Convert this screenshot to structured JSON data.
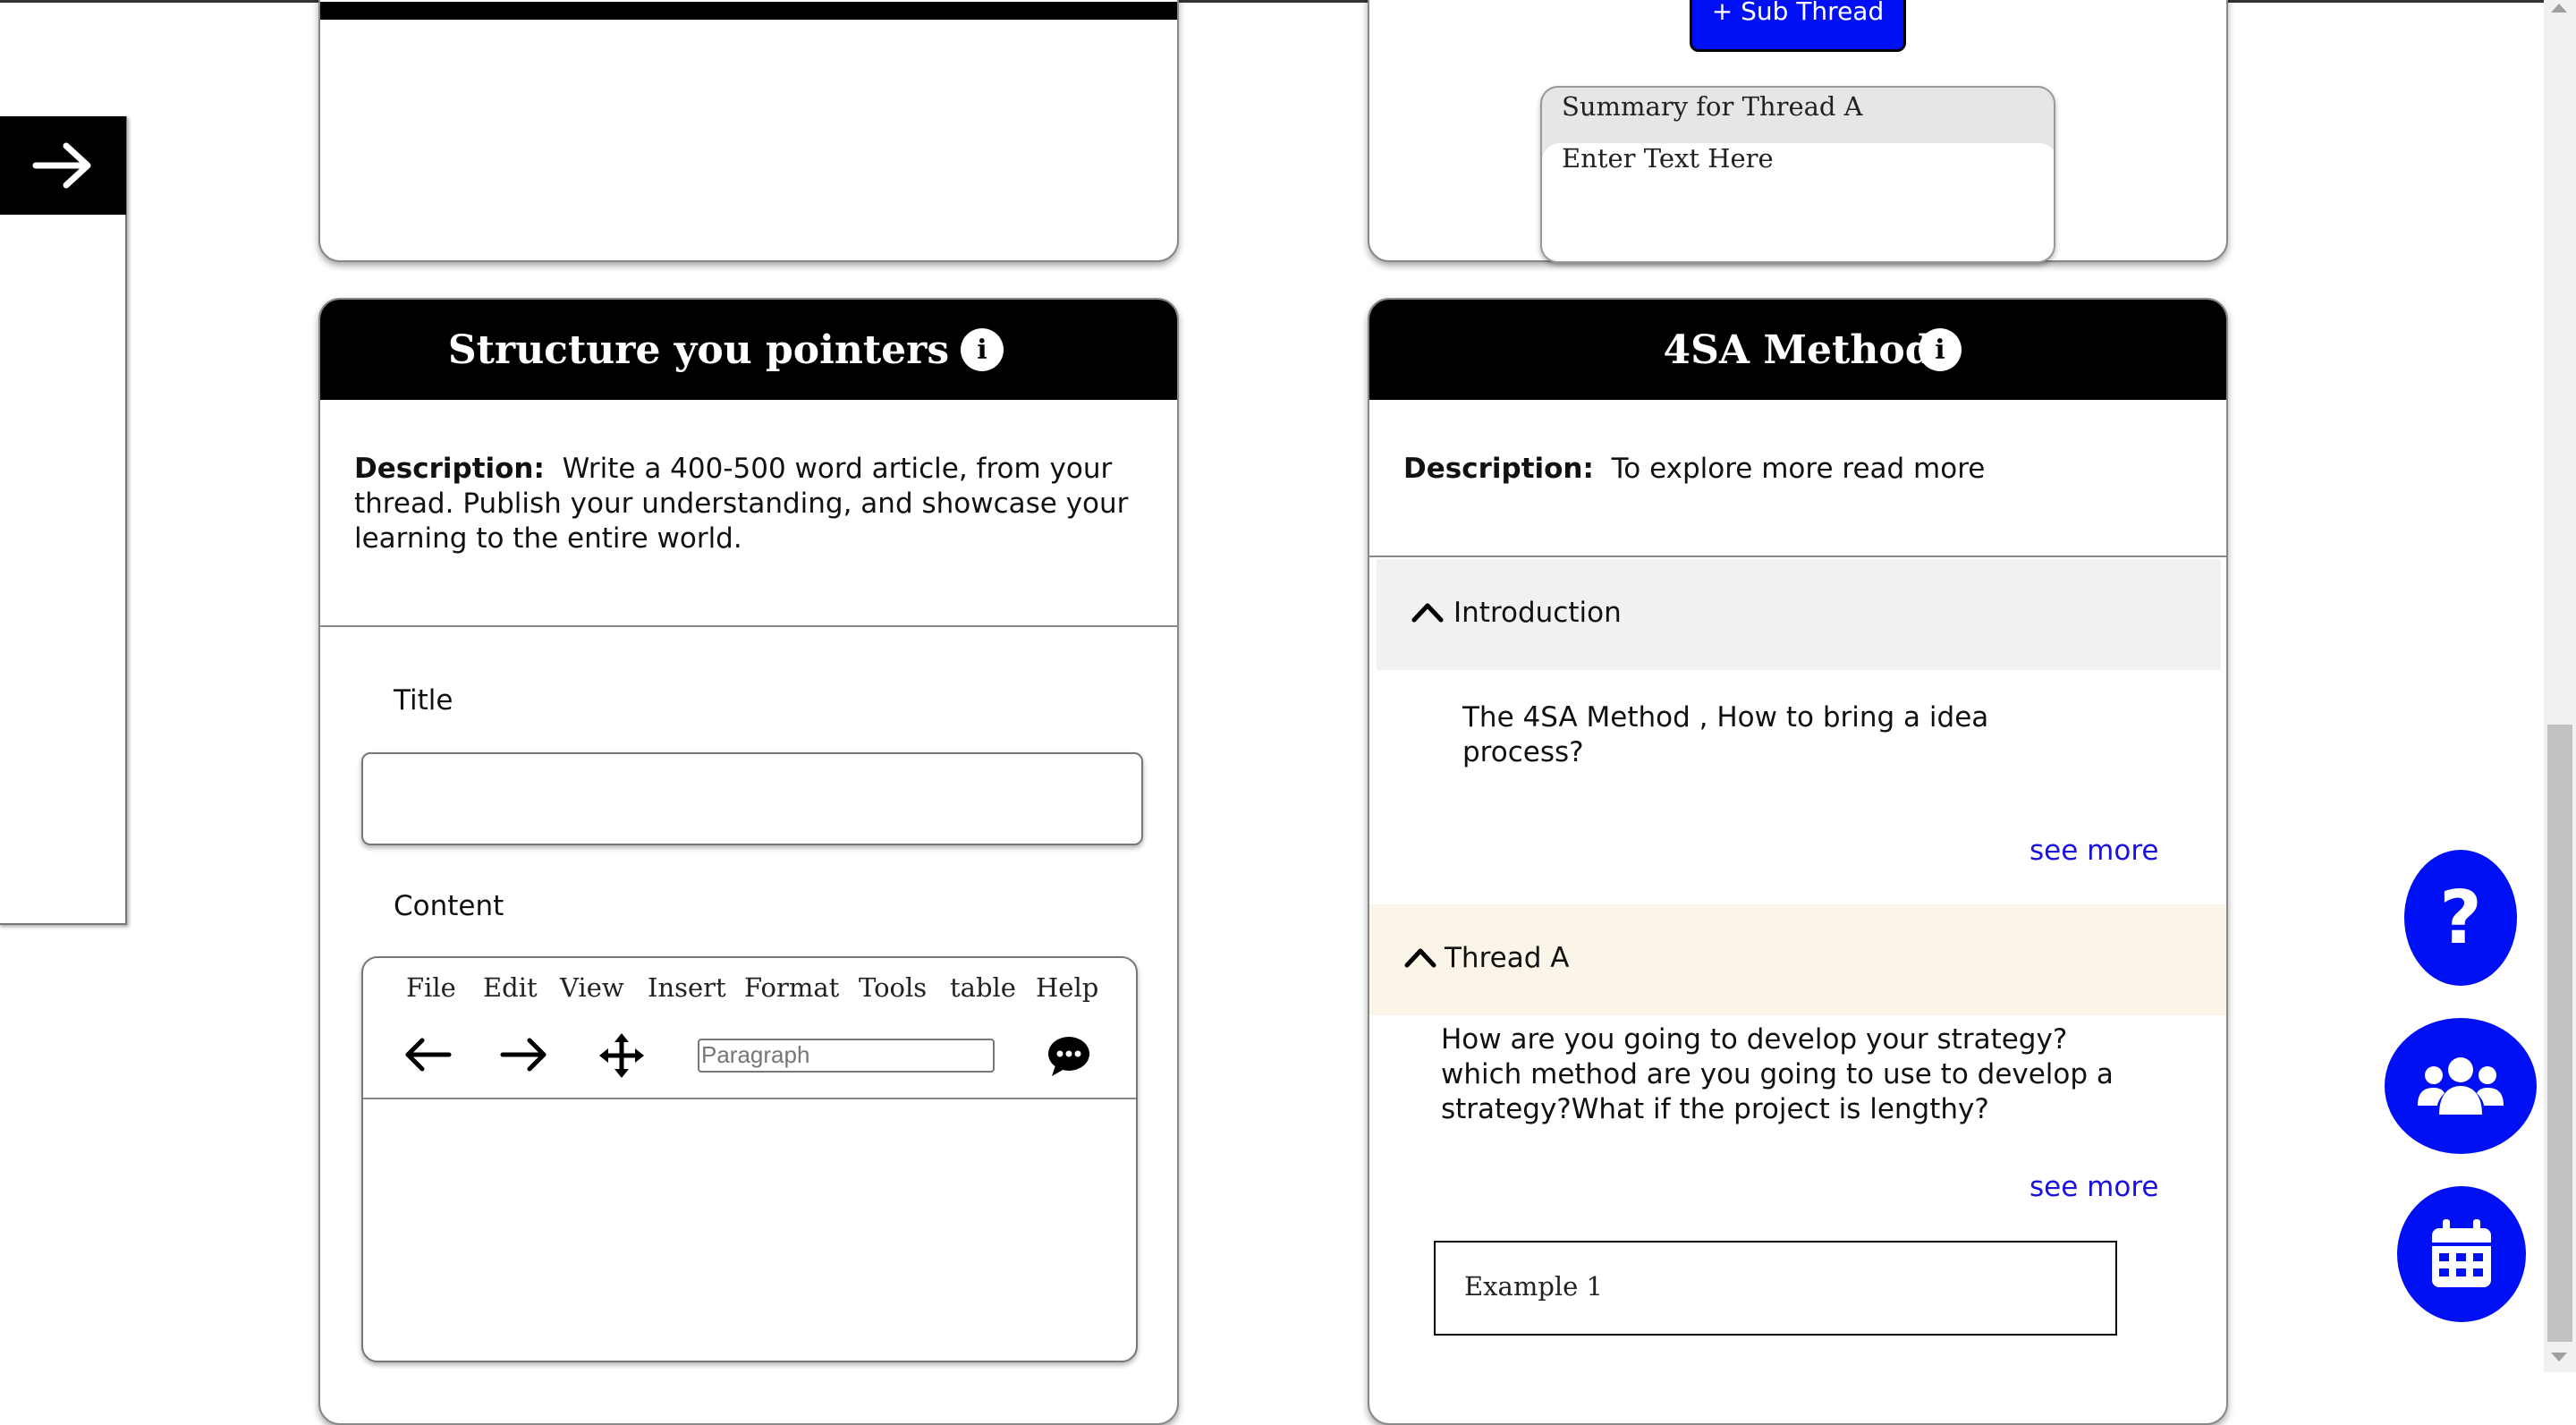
{
  "colors": {
    "accent_blue": "#0010f5",
    "link_blue": "#1a10e0",
    "header_black": "#000000",
    "thread_bg": "#fbf5e9",
    "intro_bg": "#f1f1f1"
  },
  "top_left_card": {},
  "sub_thread_button": {
    "label": "+ Sub Thread"
  },
  "summary": {
    "title": "Summary for Thread A",
    "placeholder": "Enter Text Here"
  },
  "structure_card": {
    "title": "Structure you pointers",
    "info_icon": "info-icon",
    "description_label": "Description:",
    "description_text": "Write a 400-500 word article, from your thread. Publish your understanding, and showcase your learning to the entire world.",
    "title_label": "Title",
    "content_label": "Content",
    "editor": {
      "menu": [
        "File",
        "Edit",
        "View",
        "Insert",
        "Format",
        "Tools",
        "table",
        "Help"
      ],
      "paragraph_placeholder": "Paragraph",
      "icons": [
        "undo-arrow-icon",
        "redo-arrow-icon",
        "move-icon",
        "comment-icon"
      ]
    }
  },
  "method_card": {
    "title": "4SA Method",
    "info_icon": "info-icon",
    "description_label": "Description:",
    "description_text": "To explore more read more",
    "intro": {
      "title": "Introduction",
      "text": "The 4SA Method , How to bring a idea process?",
      "see_more": "see more"
    },
    "thread": {
      "title": "Thread A",
      "text": "How are you going to develop your strategy? which method are you going to use to develop a strategy?What if the project is lengthy?",
      "see_more": "see more"
    },
    "example": "Example 1"
  },
  "fabs": [
    "help-icon",
    "users-icon",
    "calendar-icon"
  ]
}
